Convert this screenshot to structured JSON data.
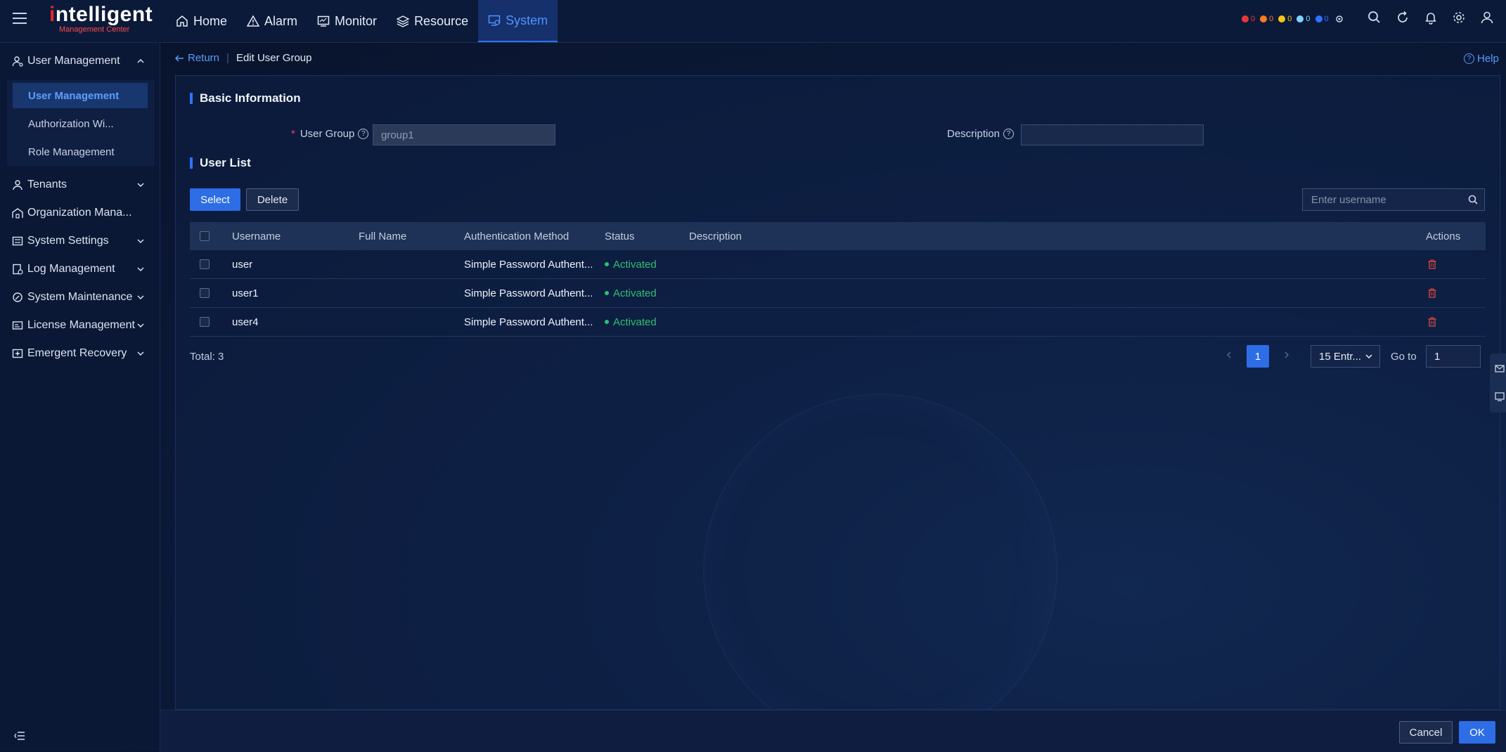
{
  "app": {
    "logo_main": "ntelligent",
    "logo_i": "i",
    "logo_sub": "Management Center"
  },
  "nav": {
    "items": [
      {
        "label": "Home",
        "icon": "home-icon"
      },
      {
        "label": "Alarm",
        "icon": "alarm-icon"
      },
      {
        "label": "Monitor",
        "icon": "monitor-icon"
      },
      {
        "label": "Resource",
        "icon": "resource-icon"
      },
      {
        "label": "System",
        "icon": "system-icon",
        "active": true
      }
    ]
  },
  "alarm_counts": [
    {
      "color": "#e53935",
      "count": "0"
    },
    {
      "color": "#ff7a1a",
      "count": "0"
    },
    {
      "color": "#f5c518",
      "count": "0"
    },
    {
      "color": "#7fd3ff",
      "count": "0"
    },
    {
      "color": "#2f73ff",
      "count": "0"
    }
  ],
  "sidebar": {
    "items": [
      {
        "label": "User Management",
        "expanded": true
      },
      {
        "label": "Tenants"
      },
      {
        "label": "Organization Mana..."
      },
      {
        "label": "System Settings"
      },
      {
        "label": "Log Management"
      },
      {
        "label": "System Maintenance"
      },
      {
        "label": "License Management"
      },
      {
        "label": "Emergent Recovery"
      }
    ],
    "sub_items": [
      {
        "label": "User Management",
        "active": true
      },
      {
        "label": "Authorization Wi..."
      },
      {
        "label": "Role Management"
      }
    ]
  },
  "breadcrumb": {
    "return": "Return",
    "current": "Edit User Group"
  },
  "help": "Help",
  "basic_info": {
    "title": "Basic Information",
    "user_group_label": "User Group",
    "user_group_value": "group1",
    "description_label": "Description",
    "description_value": ""
  },
  "user_list": {
    "title": "User List",
    "select_btn": "Select",
    "delete_btn": "Delete",
    "search_placeholder": "Enter username",
    "columns": [
      "Username",
      "Full Name",
      "Authentication Method",
      "Status",
      "Description",
      "Actions"
    ],
    "rows": [
      {
        "username": "user",
        "full_name": "",
        "auth": "Simple Password Authent...",
        "status": "Activated",
        "description": ""
      },
      {
        "username": "user1",
        "full_name": "",
        "auth": "Simple Password Authent...",
        "status": "Activated",
        "description": ""
      },
      {
        "username": "user4",
        "full_name": "",
        "auth": "Simple Password Authent...",
        "status": "Activated",
        "description": ""
      }
    ],
    "total": "Total: 3",
    "page": "1",
    "page_size": "15 Entr...",
    "goto_label": "Go to",
    "goto_value": "1"
  },
  "footer": {
    "cancel": "Cancel",
    "ok": "OK"
  }
}
